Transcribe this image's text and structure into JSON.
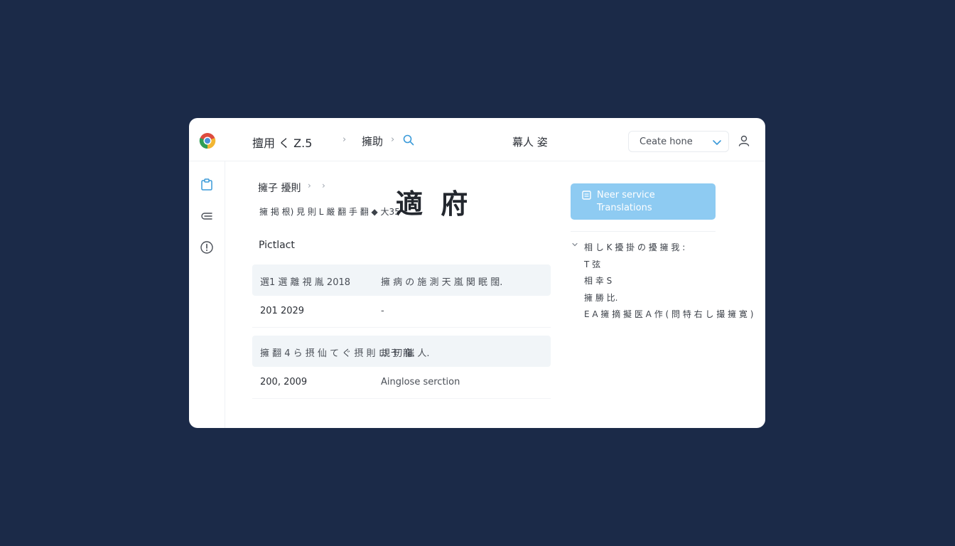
{
  "topbar": {
    "app_title": "擅用 く Z.5",
    "crumb": "擁助",
    "center_title": "幕人 姿",
    "dropdown_value": "Ceate hone"
  },
  "sidebar": {
    "items": [
      {
        "icon": "clipboard-icon"
      },
      {
        "icon": "menu-lines-icon"
      },
      {
        "icon": "info-icon"
      }
    ]
  },
  "main": {
    "breadcrumb": "擁子 擾則",
    "subline": "擁 掲 根) 見 則 L 嚴 翻 手 翻 ◆ 大35",
    "heading": "適 府",
    "section_label": "Pictlact",
    "rows": [
      {
        "col1": "選1 選 離 視 胤 2018",
        "col2": "擁 病 の 施 測 天 嵐 関 眠 闊."
      },
      {
        "col1": "201 2029",
        "col2": "-"
      },
      {
        "col1": "擁 翻 4 ら 摂 仙 て ぐ 摂 則 ロ 于 龍.",
        "col2": "規 切 催 人."
      },
      {
        "col1": "200, 2009",
        "col2": "Ainglose serction"
      }
    ]
  },
  "right_panel": {
    "service_button": {
      "line1": "Neer service",
      "line2": "Translations"
    },
    "tree": [
      "相 し K 擾 掛 の 擾 擁 我 :",
      "T 弦",
      "相 幸 S",
      "擁 勝 比.",
      "E A 擁 摘 擬 医 A 作 ( 問 特 右 し 撮 擁 寛 )"
    ]
  },
  "colors": {
    "background": "#1b2a48",
    "accent": "#8ecbf2",
    "window": "#ffffff"
  }
}
